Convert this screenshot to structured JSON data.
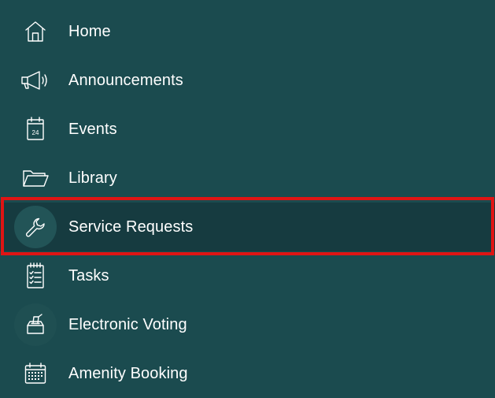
{
  "menu": {
    "items": [
      {
        "label": "Home",
        "icon": "home-icon"
      },
      {
        "label": "Announcements",
        "icon": "megaphone-icon"
      },
      {
        "label": "Events",
        "icon": "calendar-day-icon",
        "icon_text": "24"
      },
      {
        "label": "Library",
        "icon": "folder-icon"
      },
      {
        "label": "Service Requests",
        "icon": "wrench-icon",
        "selected": true
      },
      {
        "label": "Tasks",
        "icon": "checklist-icon"
      },
      {
        "label": "Electronic Voting",
        "icon": "ballot-box-icon"
      },
      {
        "label": "Amenity Booking",
        "icon": "calendar-grid-icon"
      }
    ]
  },
  "colors": {
    "background": "#1b4b4f",
    "selected_background": "#163b40",
    "highlight_border": "#e01414",
    "text": "#ffffff"
  }
}
